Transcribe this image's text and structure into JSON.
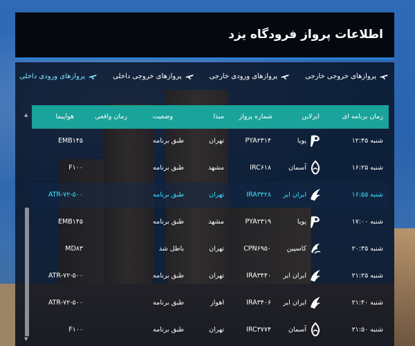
{
  "header": {
    "title": "اطلاعات پرواز فرودگاه یزد"
  },
  "tabs": [
    {
      "label": "پروازهای ورودی داخلی",
      "active": true
    },
    {
      "label": "پروازهای خروجی داخلی",
      "active": false
    },
    {
      "label": "پروازهای ورودی خارجی",
      "active": false
    },
    {
      "label": "پروازهای خروجی خارجی",
      "active": false
    }
  ],
  "table": {
    "columns": [
      "زمان برنامه ای",
      "ایرلاین",
      "شماره پرواز",
      "مبدا",
      "وضعیت",
      "زمان واقعی",
      "هواپیما"
    ],
    "rows": [
      {
        "time": "شنبه ۱۲:۴۵",
        "airline": "پویا",
        "flight": "PYA۲۳۱۴",
        "origin": "تهران",
        "status": "طبق برنامه",
        "actual": "",
        "aircraft": "EMB۱۴۵",
        "logo": "pouya",
        "highlight": false
      },
      {
        "time": "شنبه ۱۶:۲۵",
        "airline": "آسمان",
        "flight": "IRC۶۱۸",
        "origin": "مشهد",
        "status": "طبق برنامه",
        "actual": "",
        "aircraft": "F۱۰۰",
        "logo": "aseman",
        "highlight": false
      },
      {
        "time": "شنبه ۱۶:۵۵",
        "airline": "ایران ایر",
        "flight": "IRA۳۴۲۸",
        "origin": "تهران",
        "status": "طبق برنامه",
        "actual": "",
        "aircraft": "ATR-۷۲-۵۰۰",
        "logo": "iranair",
        "highlight": true
      },
      {
        "time": "شنبه ۱۷:۰۰",
        "airline": "پویا",
        "flight": "PYA۲۳۱۹",
        "origin": "مشهد",
        "status": "طبق برنامه",
        "actual": "",
        "aircraft": "EMB۱۴۵",
        "logo": "pouya",
        "highlight": false
      },
      {
        "time": "شنبه ۲۰:۳۵",
        "airline": "کاسپین",
        "flight": "CPN۶۹۵۰",
        "origin": "تهران",
        "status": "باطل شد",
        "actual": "",
        "aircraft": "MD۸۳",
        "logo": "caspian",
        "highlight": false
      },
      {
        "time": "شنبه ۲۱:۲۵",
        "airline": "ایران ایر",
        "flight": "IRA۳۴۴۰",
        "origin": "تهران",
        "status": "طبق برنامه",
        "actual": "",
        "aircraft": "ATR-۷۲-۵۰۰",
        "logo": "iranair",
        "highlight": false
      },
      {
        "time": "شنبه ۲۱:۴۰",
        "airline": "ایران ایر",
        "flight": "IRA۳۴۰۶",
        "origin": "اهواز",
        "status": "طبق برنامه",
        "actual": "",
        "aircraft": "ATR-۷۲-۵۰۰",
        "logo": "iranair",
        "highlight": false
      },
      {
        "time": "شنبه ۲۱:۵۰",
        "airline": "آسمان",
        "flight": "IRC۳۷۷۴",
        "origin": "تهران",
        "status": "طبق برنامه",
        "actual": "",
        "aircraft": "F۱۰۰",
        "logo": "aseman",
        "highlight": false
      }
    ]
  },
  "colors": {
    "header_bg": "#05080f",
    "accent_blue": "#2a7fd0",
    "table_head": "#1aa39a",
    "highlight_text": "#3fe0ff",
    "active_tab": "#7fe4ff"
  },
  "icons": {
    "tab": "airplane-icon",
    "scroll_up": "scroll-up-arrow",
    "scroll_down": "scroll-down-arrow"
  }
}
